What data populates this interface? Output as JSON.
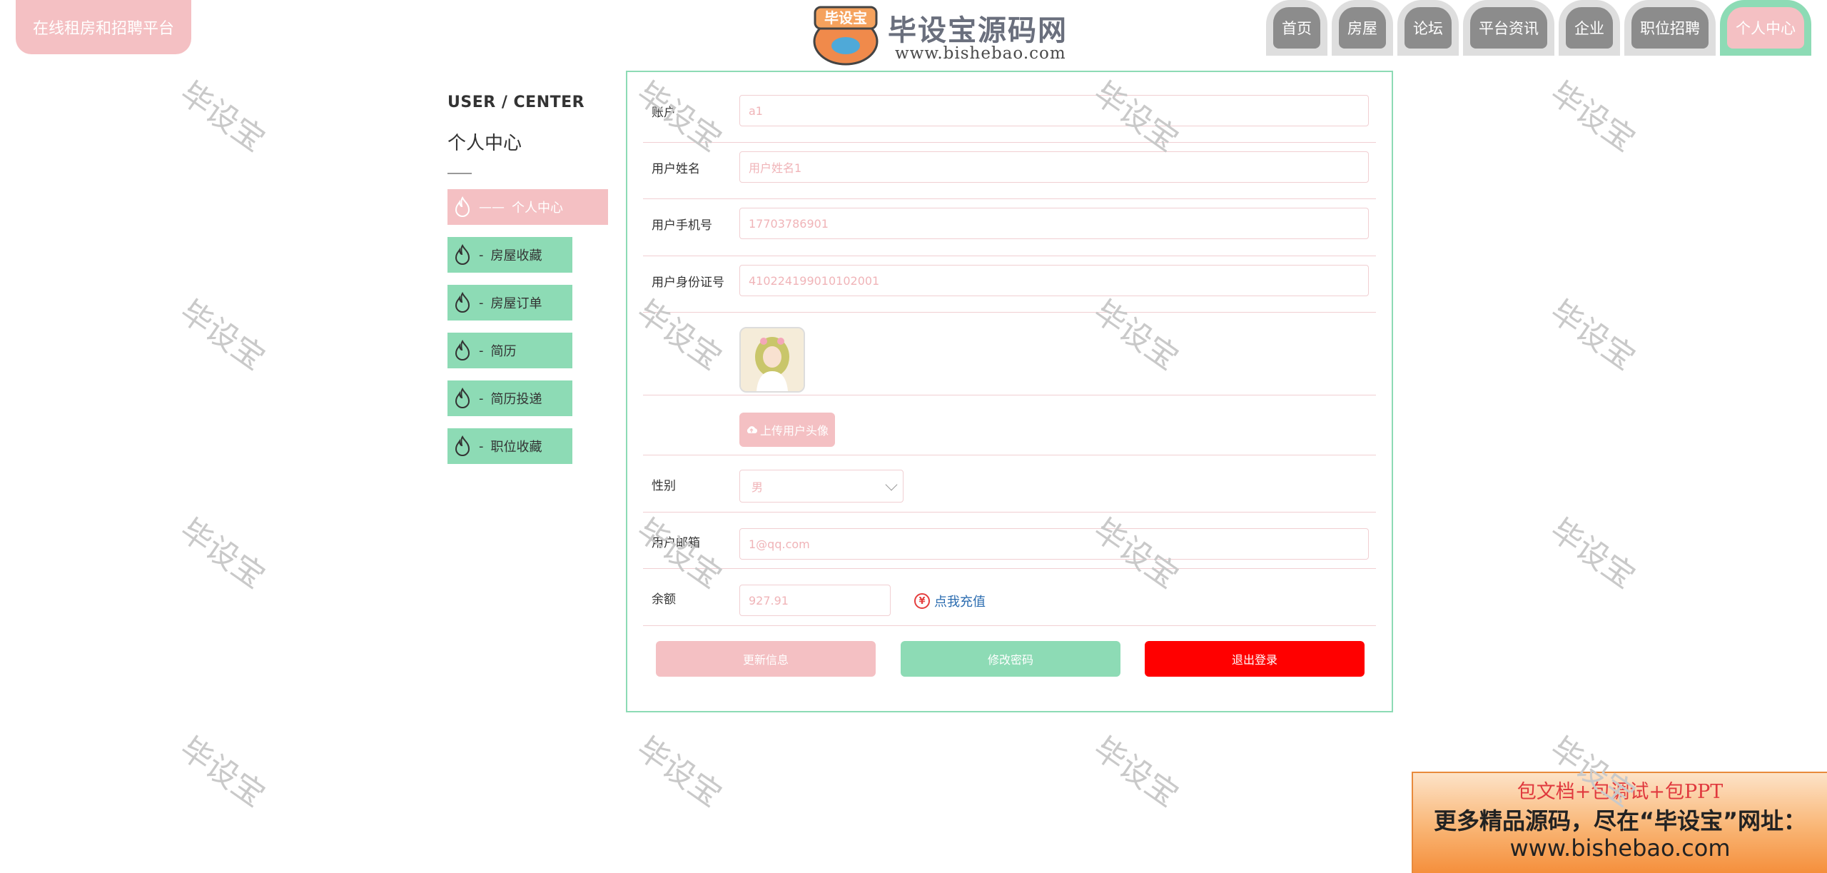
{
  "header": {
    "site_title": "在线租房和招聘平台",
    "logo_badge": "毕设宝",
    "logo_text": "毕设宝源码网",
    "logo_url": "www.bishebao.com",
    "nav": [
      {
        "label": "首页",
        "active": false
      },
      {
        "label": "房屋",
        "active": false
      },
      {
        "label": "论坛",
        "active": false
      },
      {
        "label": "平台资讯",
        "active": false
      },
      {
        "label": "企业",
        "active": false
      },
      {
        "label": "职位招聘",
        "active": false
      },
      {
        "label": "个人中心",
        "active": true
      }
    ]
  },
  "watermark": "毕设宝",
  "sidebar": {
    "heading_en": "USER / CENTER",
    "heading_cn": "个人中心",
    "items": [
      {
        "prefix": "——",
        "label": "个人中心",
        "active": true
      },
      {
        "prefix": "-",
        "label": "房屋收藏",
        "active": false
      },
      {
        "prefix": "-",
        "label": "房屋订单",
        "active": false
      },
      {
        "prefix": "-",
        "label": "简历",
        "active": false
      },
      {
        "prefix": "-",
        "label": "简历投递",
        "active": false
      },
      {
        "prefix": "-",
        "label": "职位收藏",
        "active": false
      }
    ]
  },
  "form": {
    "account": {
      "label": "账户",
      "value": "a1"
    },
    "name": {
      "label": "用户姓名",
      "value": "用户姓名1"
    },
    "phone": {
      "label": "用户手机号",
      "value": "17703786901"
    },
    "id_card": {
      "label": "用户身份证号",
      "value": "410224199010102001"
    },
    "upload_label": "上传用户头像",
    "gender": {
      "label": "性别",
      "value": "男"
    },
    "email": {
      "label": "用户邮箱",
      "value": "1@qq.com"
    },
    "balance": {
      "label": "余额",
      "value": "927.91"
    },
    "recharge_label": "点我充值",
    "recharge_icon": "¥",
    "buttons": {
      "update": "更新信息",
      "change_password": "修改密码",
      "logout": "退出登录"
    }
  },
  "promo": {
    "line1": "包文档+包调试+包PPT",
    "line2": "更多精品源码，尽在“毕设宝”网址：",
    "line3": "www.bishebao.com"
  },
  "colors": {
    "pink": "#f4c0c3",
    "green": "#8ddbb5",
    "red": "#ff0000",
    "nav_gray": "#8c8c8c"
  }
}
